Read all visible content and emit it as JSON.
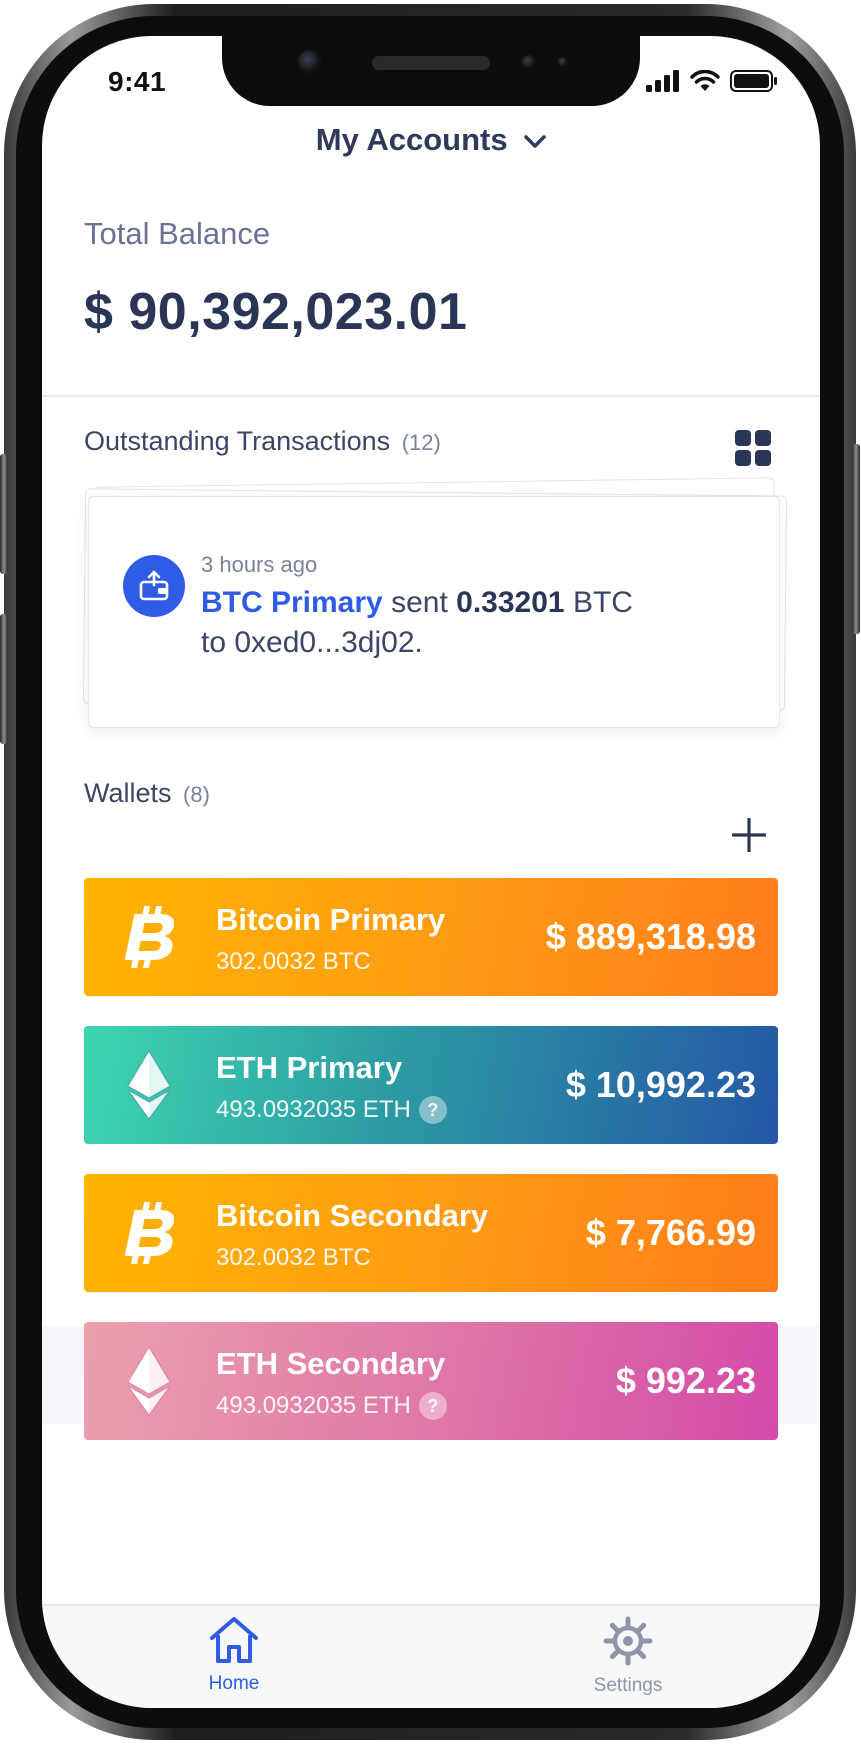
{
  "status": {
    "time": "9:41"
  },
  "header": {
    "title": "My Accounts"
  },
  "balance": {
    "label": "Total Balance",
    "value": "$ 90,392,023.01"
  },
  "transactions": {
    "title": "Outstanding Transactions",
    "count": "(12)",
    "latest": {
      "time": "3 hours ago",
      "account": "BTC Primary",
      "verb": "sent",
      "amount": "0.33201",
      "currency": "BTC",
      "to_prefix": "to",
      "address": "0xed0...3dj02."
    }
  },
  "wallets": {
    "title": "Wallets",
    "count": "(8)",
    "items": [
      {
        "name": "Bitcoin Primary",
        "amount": "302.0032 BTC",
        "value": "$ 889,318.98",
        "coin": "bitcoin-icon"
      },
      {
        "name": "ETH Primary",
        "amount": "493.0932035 ETH",
        "value": "$ 10,992.23",
        "coin": "ethereum-icon"
      },
      {
        "name": "Bitcoin Secondary",
        "amount": "302.0032 BTC",
        "value": "$ 7,766.99",
        "coin": "bitcoin-icon"
      },
      {
        "name": "ETH Secondary",
        "amount": "493.0932035 ETH",
        "value": "$ 992.23",
        "coin": "ethereum-icon"
      }
    ],
    "help_mark": "?"
  },
  "tabs": [
    {
      "label": "Home",
      "icon": "home-icon",
      "active": true
    },
    {
      "label": "Settings",
      "icon": "gear-icon",
      "active": false
    }
  ],
  "colors": {
    "accent": "#2f5be6",
    "text_dark": "#2b3656",
    "btc_gradient": [
      "#ffb400",
      "#ff7d1c"
    ],
    "eth_gradient": [
      "#3dd6b0",
      "#2557a6"
    ],
    "eth2_gradient": [
      "#eba0ad",
      "#d44aa9"
    ]
  }
}
